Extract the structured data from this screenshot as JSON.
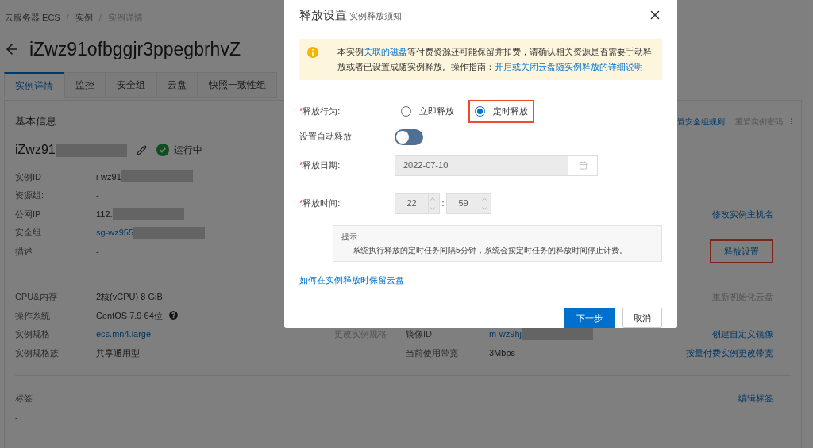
{
  "breadcrumbs": {
    "separator": "/",
    "items": [
      {
        "label": "云服务器 ECS",
        "current": false
      },
      {
        "label": "实例",
        "current": false
      },
      {
        "label": "实例详情",
        "current": true
      }
    ]
  },
  "page_title": "iZwz91ofbggjr3ppegbrhvZ",
  "tabs": [
    {
      "label": "实例详情",
      "selected": true
    },
    {
      "label": "监控",
      "selected": false
    },
    {
      "label": "安全组",
      "selected": false
    },
    {
      "label": "云盘",
      "selected": false
    },
    {
      "label": "快照一致性组",
      "selected": false
    }
  ],
  "basic_info": {
    "heading": "基本信息",
    "top_actions": [
      {
        "label": "置安全组规则",
        "disabled": false
      },
      {
        "label": "重置实例密码",
        "disabled": true
      }
    ],
    "instance_name": "iZwz91",
    "status": "运行中"
  },
  "sections": [
    {
      "rows": [
        {
          "label": "实例ID",
          "value": "i-wz91",
          "redacted": true,
          "link": false
        },
        {
          "label": "资源组:",
          "value": "-",
          "redacted": false,
          "link": false
        },
        {
          "label": "公网IP",
          "value": "112.",
          "redacted": true,
          "link": false,
          "action": {
            "label": "修改实例主机名",
            "disabled": false,
            "highlighted": false
          }
        },
        {
          "label": "安全组",
          "value": "sg-wz955",
          "redacted": true,
          "link": true
        },
        {
          "label": "描述",
          "value": "-",
          "redacted": false,
          "link": false,
          "action": {
            "label": "释放设置",
            "disabled": false,
            "highlighted": true
          }
        }
      ]
    },
    {
      "rows": [
        {
          "label": "CPU&内存",
          "value": "2核(vCPU) 8 GiB",
          "redacted": false,
          "link": false,
          "action": {
            "label": "重新初始化云盘",
            "disabled": true,
            "highlighted": false
          }
        },
        {
          "label": "操作系统",
          "value": "CentOS 7.9 64位",
          "redacted": false,
          "link": false,
          "help": true
        },
        {
          "label": "实例规格",
          "value": "ecs.mn4.large",
          "redacted": false,
          "link": true,
          "middle": {
            "action": {
              "label": "更改实例规格",
              "disabled": true
            },
            "label": "镜像ID",
            "value": "m-wz9hj",
            "redacted": true,
            "link": true
          },
          "action": {
            "label": "创建自定义镜像",
            "disabled": false,
            "highlighted": false
          }
        },
        {
          "label": "实例规格族",
          "value": "共享通用型",
          "redacted": false,
          "link": false,
          "middle": {
            "label": "当前使用带宽",
            "value": "3Mbps",
            "redacted": false,
            "link": false
          },
          "action": {
            "label": "按量付费实例更改带宽",
            "disabled": false,
            "highlighted": false
          }
        }
      ]
    },
    {
      "rows": [
        {
          "label": "标签",
          "action": {
            "label": "编辑标签",
            "disabled": false,
            "highlighted": false
          }
        },
        {
          "label": "-"
        }
      ]
    }
  ],
  "dialog": {
    "title": "释放设置",
    "subtitle": "实例释放须知",
    "notice": [
      "本实例",
      "等付费资源还可能保留并扣费，请确认相关资源是否需要手动释放或者已设置成随实例释放。操作指南："
    ],
    "notice_inline_link": "关联的磁盘",
    "notice_link": "开启或关闭云盘随实例释放的详细说明",
    "release_mode": {
      "label": "释放行为:",
      "required_mark": "*",
      "options": [
        {
          "label": "立即释放",
          "selected": false,
          "highlighted": false
        },
        {
          "label": "定时释放",
          "selected": true,
          "highlighted": true
        }
      ]
    },
    "auto_release": {
      "label": "设置自动释放:",
      "on": false
    },
    "date": {
      "label": "释放日期:",
      "required_mark": "*",
      "value": "2022-07-10",
      "disabled": true
    },
    "time": {
      "label": "释放时间:",
      "required_mark": "*",
      "hour": "22",
      "separator": ":",
      "minute": "59",
      "disabled": true
    },
    "tip": {
      "title": "提示:",
      "text": "系统执行释放的定时任务间隔5分钟，系统会按定时任务的释放时间停止计费。"
    },
    "help_link": "如何在实例释放时保留云盘",
    "buttons": [
      {
        "label": "下一步",
        "kind": "primary"
      },
      {
        "label": "取消",
        "kind": "secondary"
      }
    ]
  }
}
